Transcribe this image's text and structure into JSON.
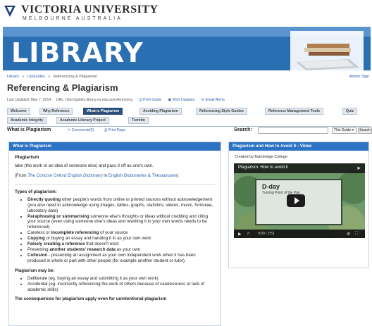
{
  "brand": {
    "name": "VICTORIA UNIVERSITY",
    "subtitle": "MELBOURNE  AUSTRALIA",
    "banner_word": "LIBRARY"
  },
  "breadcrumb": [
    "Library",
    "»",
    "LibGuides",
    "»",
    "Referencing & Plagiarism"
  ],
  "admin_sign_in": "Admin Sign",
  "page_title": "Referencing & Plagiarism",
  "meta": {
    "updated": "Last Updated: May 7, 2014",
    "url": "URL: http://guides.library.vu.edu.au/referencing",
    "print_guide": "Print Guide",
    "rss": "RSS Updates",
    "email": "Email Alerts"
  },
  "tabs": [
    "Welcome",
    "Why Reference",
    "What is Plagiarism",
    "Avoiding Plagiarism",
    "Referencing Style Guides",
    "Reference Management Tools",
    "Quiz",
    "Academic Integrity",
    "Academic Literacy Project",
    "Turnitin"
  ],
  "subbar": {
    "title": "What is Plagiarism",
    "comments": "Comments(0)",
    "print_page": "Print Page",
    "search_label": "Search:",
    "search_placeholder": "",
    "scope": "This Guide",
    "search_button": "Search"
  },
  "main": {
    "header": "What is Plagiarism",
    "heading": "Plagiarism",
    "definition": "take (the work or an idea of someone else) and pass it off as one's own.",
    "source": {
      "from": "(From ",
      "dict": "The Concise Oxford English Dictionary",
      "in": " in ",
      "coll": "English Dictionaries & Thesauruses",
      "close": ")"
    },
    "types_heading": "Types of plagiarism:",
    "types": [
      {
        "bold": "Directly quoting",
        "rest": " other people's words from online or printed sources without acknowledgement (you also need to acknowledge using images, tables, graphs, statistics, videos, music, formulae, laboratory data)"
      },
      {
        "bold": "Paraphrasing or summarising",
        "rest": " someone else's thoughts or ideas without crediting and citing your source (even using someone else's ideas and rewriting it in your own words needs to be referenced)"
      },
      {
        "pre": "Careless or ",
        "bold": "incomplete referencing",
        "rest": " of your source"
      },
      {
        "bold": "Copying",
        "rest": " or buying an essay and handing it in as your own work"
      },
      {
        "bold": "Falsely creating a reference",
        "rest": " that doesn't exist"
      },
      {
        "pre": "Presenting ",
        "bold": "another students' research data",
        "rest": " as your own"
      },
      {
        "bold": "Collusion",
        "rest": " - presenting an assignment as your own independent work when it has been produced in whole or part with other people (for example another student or tutor)."
      }
    ],
    "maybe_heading": "Plagiarism may be:",
    "maybe": [
      "Deliberate (eg. buying an essay and submitting it as your own work)",
      "Accidental (eg. incorrectly referencing the work of others because of carelessness or lack of academic skills)"
    ],
    "consequences": "The consequences for plagiarism apply even for unintentional plagiarism"
  },
  "side": {
    "header": "Plagiarism and How to Avoid it - Video",
    "created_by": "Created by Bainbridge College",
    "video_title": "Plagiarism: How to avoid it",
    "screen_title": "D-day",
    "screen_sub": "Turning Point of the War",
    "time": "0:00 / 2:51"
  }
}
